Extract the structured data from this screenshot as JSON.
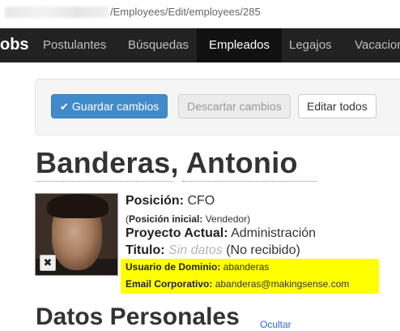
{
  "browser": {
    "url_path": "/Employees/Edit/employees/285"
  },
  "navbar": {
    "brand": "obs",
    "items": [
      {
        "label": "Postulantes"
      },
      {
        "label": "Búsquedas"
      },
      {
        "label": "Empleados",
        "active": true
      },
      {
        "label": "Legajos"
      },
      {
        "label": "Vacacion"
      }
    ]
  },
  "actions": {
    "save_label": "Guardar cambios",
    "discard_label": "Descartar cambios",
    "edit_all_label": "Editar todos"
  },
  "employee": {
    "name": "Banderas, Antonio",
    "posicion_label": "Posición:",
    "posicion_value": "CFO",
    "posicion_inicial_open": "(",
    "posicion_inicial_label": "Posición inicial:",
    "posicion_inicial_value": "Vendedor",
    "posicion_inicial_close": ")",
    "proyecto_label": "Proyecto Actual:",
    "proyecto_value": "Administración",
    "titulo_label": "Titulo:",
    "titulo_placeholder": "Sin datos",
    "titulo_status": "(No recibido)",
    "usuario_label": "Usuario de Dominio:",
    "usuario_value": "abanderas",
    "email_label": "Email Corporativo:",
    "email_value": "abanderas@makingsense.com"
  },
  "section": {
    "title": "Datos Personales",
    "toggle_label": "Ocultar"
  },
  "colors": {
    "navbar_bg": "#222222",
    "primary_button": "#428bca",
    "highlight": "#ffff00",
    "link": "#2a6ad0"
  },
  "icons": {
    "save": "check-icon",
    "remove_photo": "close-icon"
  }
}
